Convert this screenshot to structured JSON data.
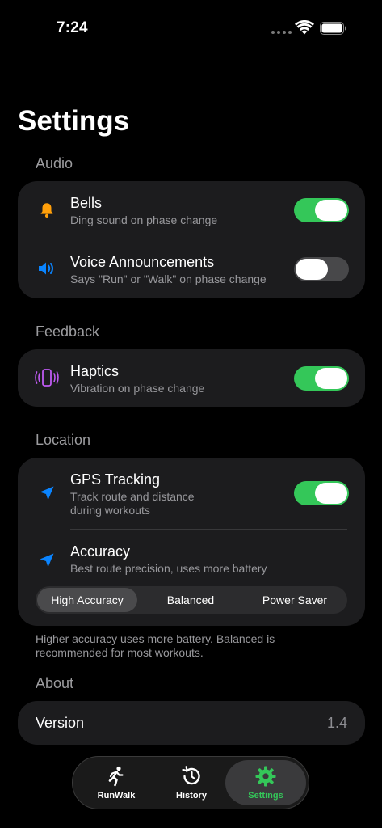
{
  "status_bar": {
    "time": "7:24"
  },
  "page_title": "Settings",
  "sections": {
    "audio": {
      "header": "Audio",
      "bells": {
        "title": "Bells",
        "subtitle": "Ding sound on phase change",
        "enabled": true
      },
      "voice": {
        "title": "Voice Announcements",
        "subtitle": "Says \"Run\" or \"Walk\" on phase change",
        "enabled": false
      }
    },
    "feedback": {
      "header": "Feedback",
      "haptics": {
        "title": "Haptics",
        "subtitle": "Vibration on phase change",
        "enabled": true
      }
    },
    "location": {
      "header": "Location",
      "gps": {
        "title": "GPS Tracking",
        "subtitle_line1": "Track route and distance",
        "subtitle_line2": "during workouts",
        "enabled": true
      },
      "accuracy": {
        "title": "Accuracy",
        "subtitle": "Best route precision, uses more battery",
        "options": [
          "High Accuracy",
          "Balanced",
          "Power Saver"
        ],
        "selected": "High Accuracy"
      },
      "footnote": "Higher accuracy uses more battery. Balanced is recommended for most workouts."
    },
    "about": {
      "header": "About",
      "version_label": "Version",
      "version_value": "1.4"
    }
  },
  "tab_bar": {
    "tabs": [
      {
        "label": "RunWalk",
        "icon": "runner-icon"
      },
      {
        "label": "History",
        "icon": "history-clock-icon"
      },
      {
        "label": "Settings",
        "icon": "gear-icon"
      }
    ],
    "active": "Settings"
  },
  "colors": {
    "toggle_on": "#34c759",
    "toggle_off": "#48484a",
    "bell": "#ff9f0a",
    "speaker": "#0a84ff",
    "haptics": "#bf5af2",
    "location": "#0a84ff",
    "active_tab": "#34c759"
  }
}
